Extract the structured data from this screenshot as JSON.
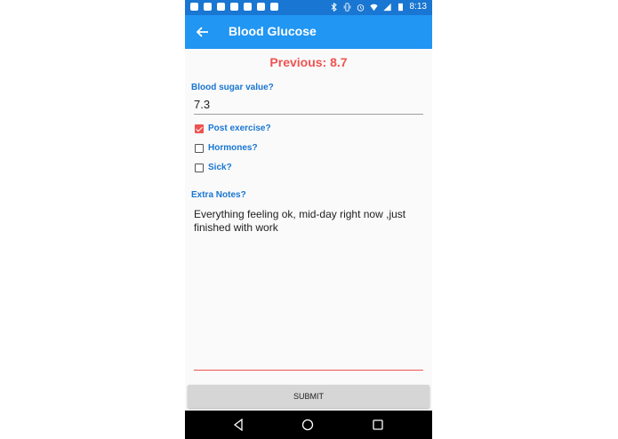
{
  "status_bar": {
    "time": "8:13",
    "notification_icons": [
      "snapchat-icon",
      "gamepad-icon",
      "emoji-icon",
      "gmail-icon",
      "upload-icon",
      "image-icon",
      "phone-outline-icon"
    ],
    "system_icons": [
      "bluetooth-icon",
      "vibrate-icon",
      "alarm-icon",
      "wifi-icon",
      "signal-icon",
      "battery-icon"
    ]
  },
  "app_bar": {
    "title": "Blood Glucose",
    "back_icon": "arrow-left-icon",
    "color": "#2196f3"
  },
  "form": {
    "previous": "Previous: 8.7",
    "blood_sugar_label": "Blood sugar value?",
    "blood_sugar_value": "7.3",
    "checkboxes": [
      {
        "label": "Post exercise?",
        "checked": true
      },
      {
        "label": "Hormones?",
        "checked": false
      },
      {
        "label": "Sick?",
        "checked": false
      }
    ],
    "notes_label": "Extra Notes?",
    "notes_value": "Everything feeling ok, mid-day right now ,just finished with work",
    "submit_label": "SUBMIT"
  },
  "colors": {
    "accent": "#ef5350",
    "label_blue": "#1976d2"
  }
}
